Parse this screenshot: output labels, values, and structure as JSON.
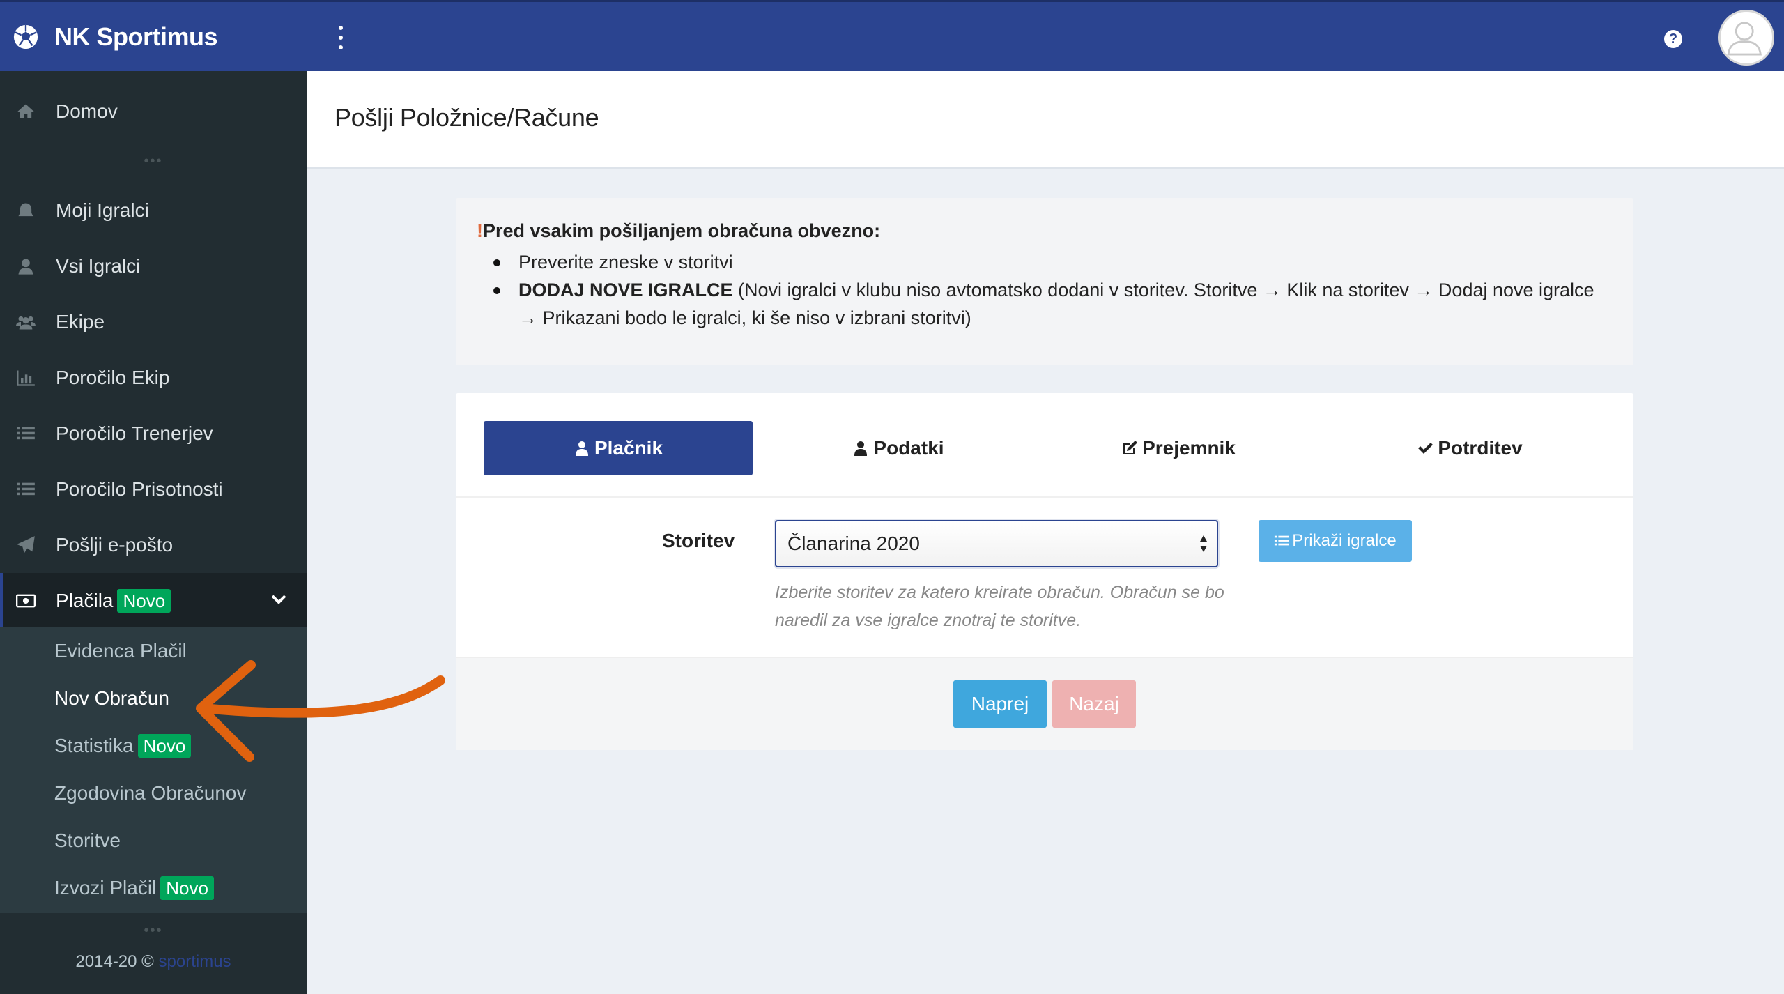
{
  "header": {
    "brand": "NK Sportimus",
    "help_icon": "question-circle-icon",
    "menu_icon": "vertical-dots-icon",
    "colors": {
      "primary": "#2b4490",
      "sidebar": "#222d32",
      "submenu": "#2c3b41",
      "badge": "#00a65a"
    }
  },
  "sidebar": {
    "items": [
      {
        "label": "Domov",
        "icon": "home-icon"
      },
      {
        "label": "Moji Igralci",
        "icon": "user-bust-icon"
      },
      {
        "label": "Vsi Igralci",
        "icon": "user-icon"
      },
      {
        "label": "Ekipe",
        "icon": "users-icon"
      },
      {
        "label": "Poročilo Ekip",
        "icon": "bar-chart-icon"
      },
      {
        "label": "Poročilo Trenerjev",
        "icon": "list-icon"
      },
      {
        "label": "Poročilo Prisotnosti",
        "icon": "list-icon"
      },
      {
        "label": "Pošlji e-pošto",
        "icon": "paper-plane-icon"
      }
    ],
    "payments": {
      "label": "Plačila",
      "badge": "Novo",
      "icon": "money-icon"
    },
    "submenu": [
      {
        "label": "Evidenca Plačil",
        "badge": ""
      },
      {
        "label": "Nov Obračun",
        "badge": ""
      },
      {
        "label": "Statistika",
        "badge": "Novo"
      },
      {
        "label": "Zgodovina Obračunov",
        "badge": ""
      },
      {
        "label": "Storitve",
        "badge": ""
      },
      {
        "label": "Izvozi Plačil",
        "badge": "Novo"
      }
    ],
    "footer": {
      "text": "2014-20 ©",
      "link": "sportimus"
    }
  },
  "page": {
    "title": "Pošlji Položnice/Račune",
    "notice": {
      "mark": "!",
      "title": "Pred vsakim pošiljanjem obračuna obvezno:",
      "item1": "Preverite zneske v storitvi",
      "item2_bold": "DODAJ NOVE IGRALCE",
      "item2_rest": " (Novi igralci v klubu niso avtomatsko dodani v storitev. Storitve → Klik na storitev → Dodaj nove igralce → Prikazani bodo le igralci, ki še niso v izbrani storitvi)"
    },
    "steps": [
      {
        "label": "Plačnik",
        "icon": "user-icon",
        "active": true
      },
      {
        "label": "Podatki",
        "icon": "user-icon",
        "active": false
      },
      {
        "label": "Prejemnik",
        "icon": "edit-icon",
        "active": false
      },
      {
        "label": "Potrditev",
        "icon": "check-icon",
        "active": false
      }
    ],
    "form": {
      "label": "Storitev",
      "selected": "Članarina 2020",
      "show_button": "Prikaži igralce",
      "help": "Izberite storitev za katero kreirate obračun. Obračun se bo naredil za vse igralce znotraj te storitve."
    },
    "buttons": {
      "next": "Naprej",
      "back": "Nazaj"
    }
  }
}
